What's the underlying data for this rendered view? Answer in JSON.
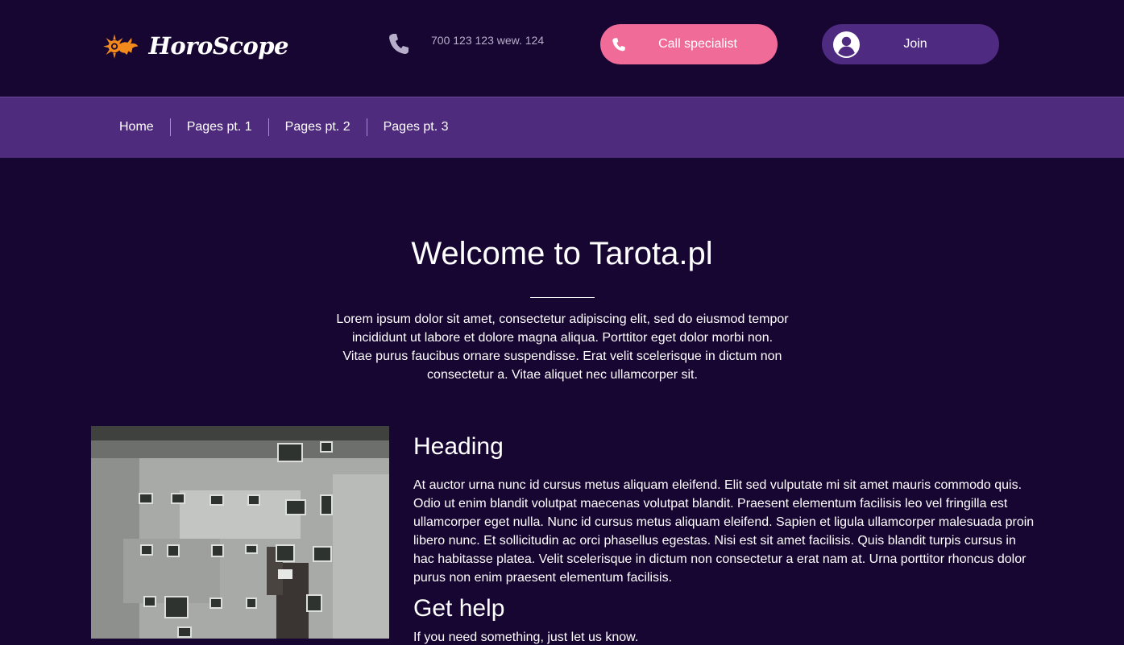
{
  "header": {
    "logo_text": "HoroScope",
    "phone_number": "700 123 123 wew. 124",
    "call_button_label": "Call specialist",
    "join_button_label": "Join",
    "icons": {
      "logo": "capricorn-sun-logo",
      "phone": "phone-icon",
      "call": "phone-icon",
      "join": "user-circle-icon"
    }
  },
  "nav": {
    "items": [
      {
        "label": "Home"
      },
      {
        "label": "Pages pt. 1"
      },
      {
        "label": "Pages pt. 2"
      },
      {
        "label": "Pages pt. 3"
      }
    ]
  },
  "hero": {
    "title": "Welcome to Tarota.pl",
    "text": "Lorem ipsum dolor sit amet, consectetur adipiscing elit, sed do eiusmod tempor incididunt ut labore et dolore magna aliqua. Porttitor eget dolor morbi non. Vitae purus faucibus ornare suspendisse. Erat velit scelerisque in dictum non consectetur a. Vitae aliquet nec ullamcorper sit."
  },
  "content": {
    "heading": "Heading",
    "paragraph": "At auctor urna nunc id cursus metus aliquam eleifend. Elit sed vulputate mi sit amet mauris commodo quis. Odio ut enim blandit volutpat maecenas volutpat blandit. Praesent elementum facilisis leo vel fringilla est ullamcorper eget nulla. Nunc id cursus metus aliquam eleifend. Sapien et ligula ullamcorper malesuada proin libero nunc. Et sollicitudin ac orci phasellus egestas. Nisi est sit amet facilisis. Quis blandit turpis cursus in hac habitasse platea. Velit scelerisque in dictum non consectetur a erat nam at. Urna porttitor rhoncus dolor purus non enim praesent elementum facilisis.",
    "get_help_heading": "Get help",
    "get_help_text": "If you need something, just let us know."
  },
  "colors": {
    "background": "#170532",
    "navbar": "#4f2b7e",
    "accent_pink": "#f06b98",
    "join_button": "#4e2a80",
    "logo_orange": "#f28a1c"
  }
}
